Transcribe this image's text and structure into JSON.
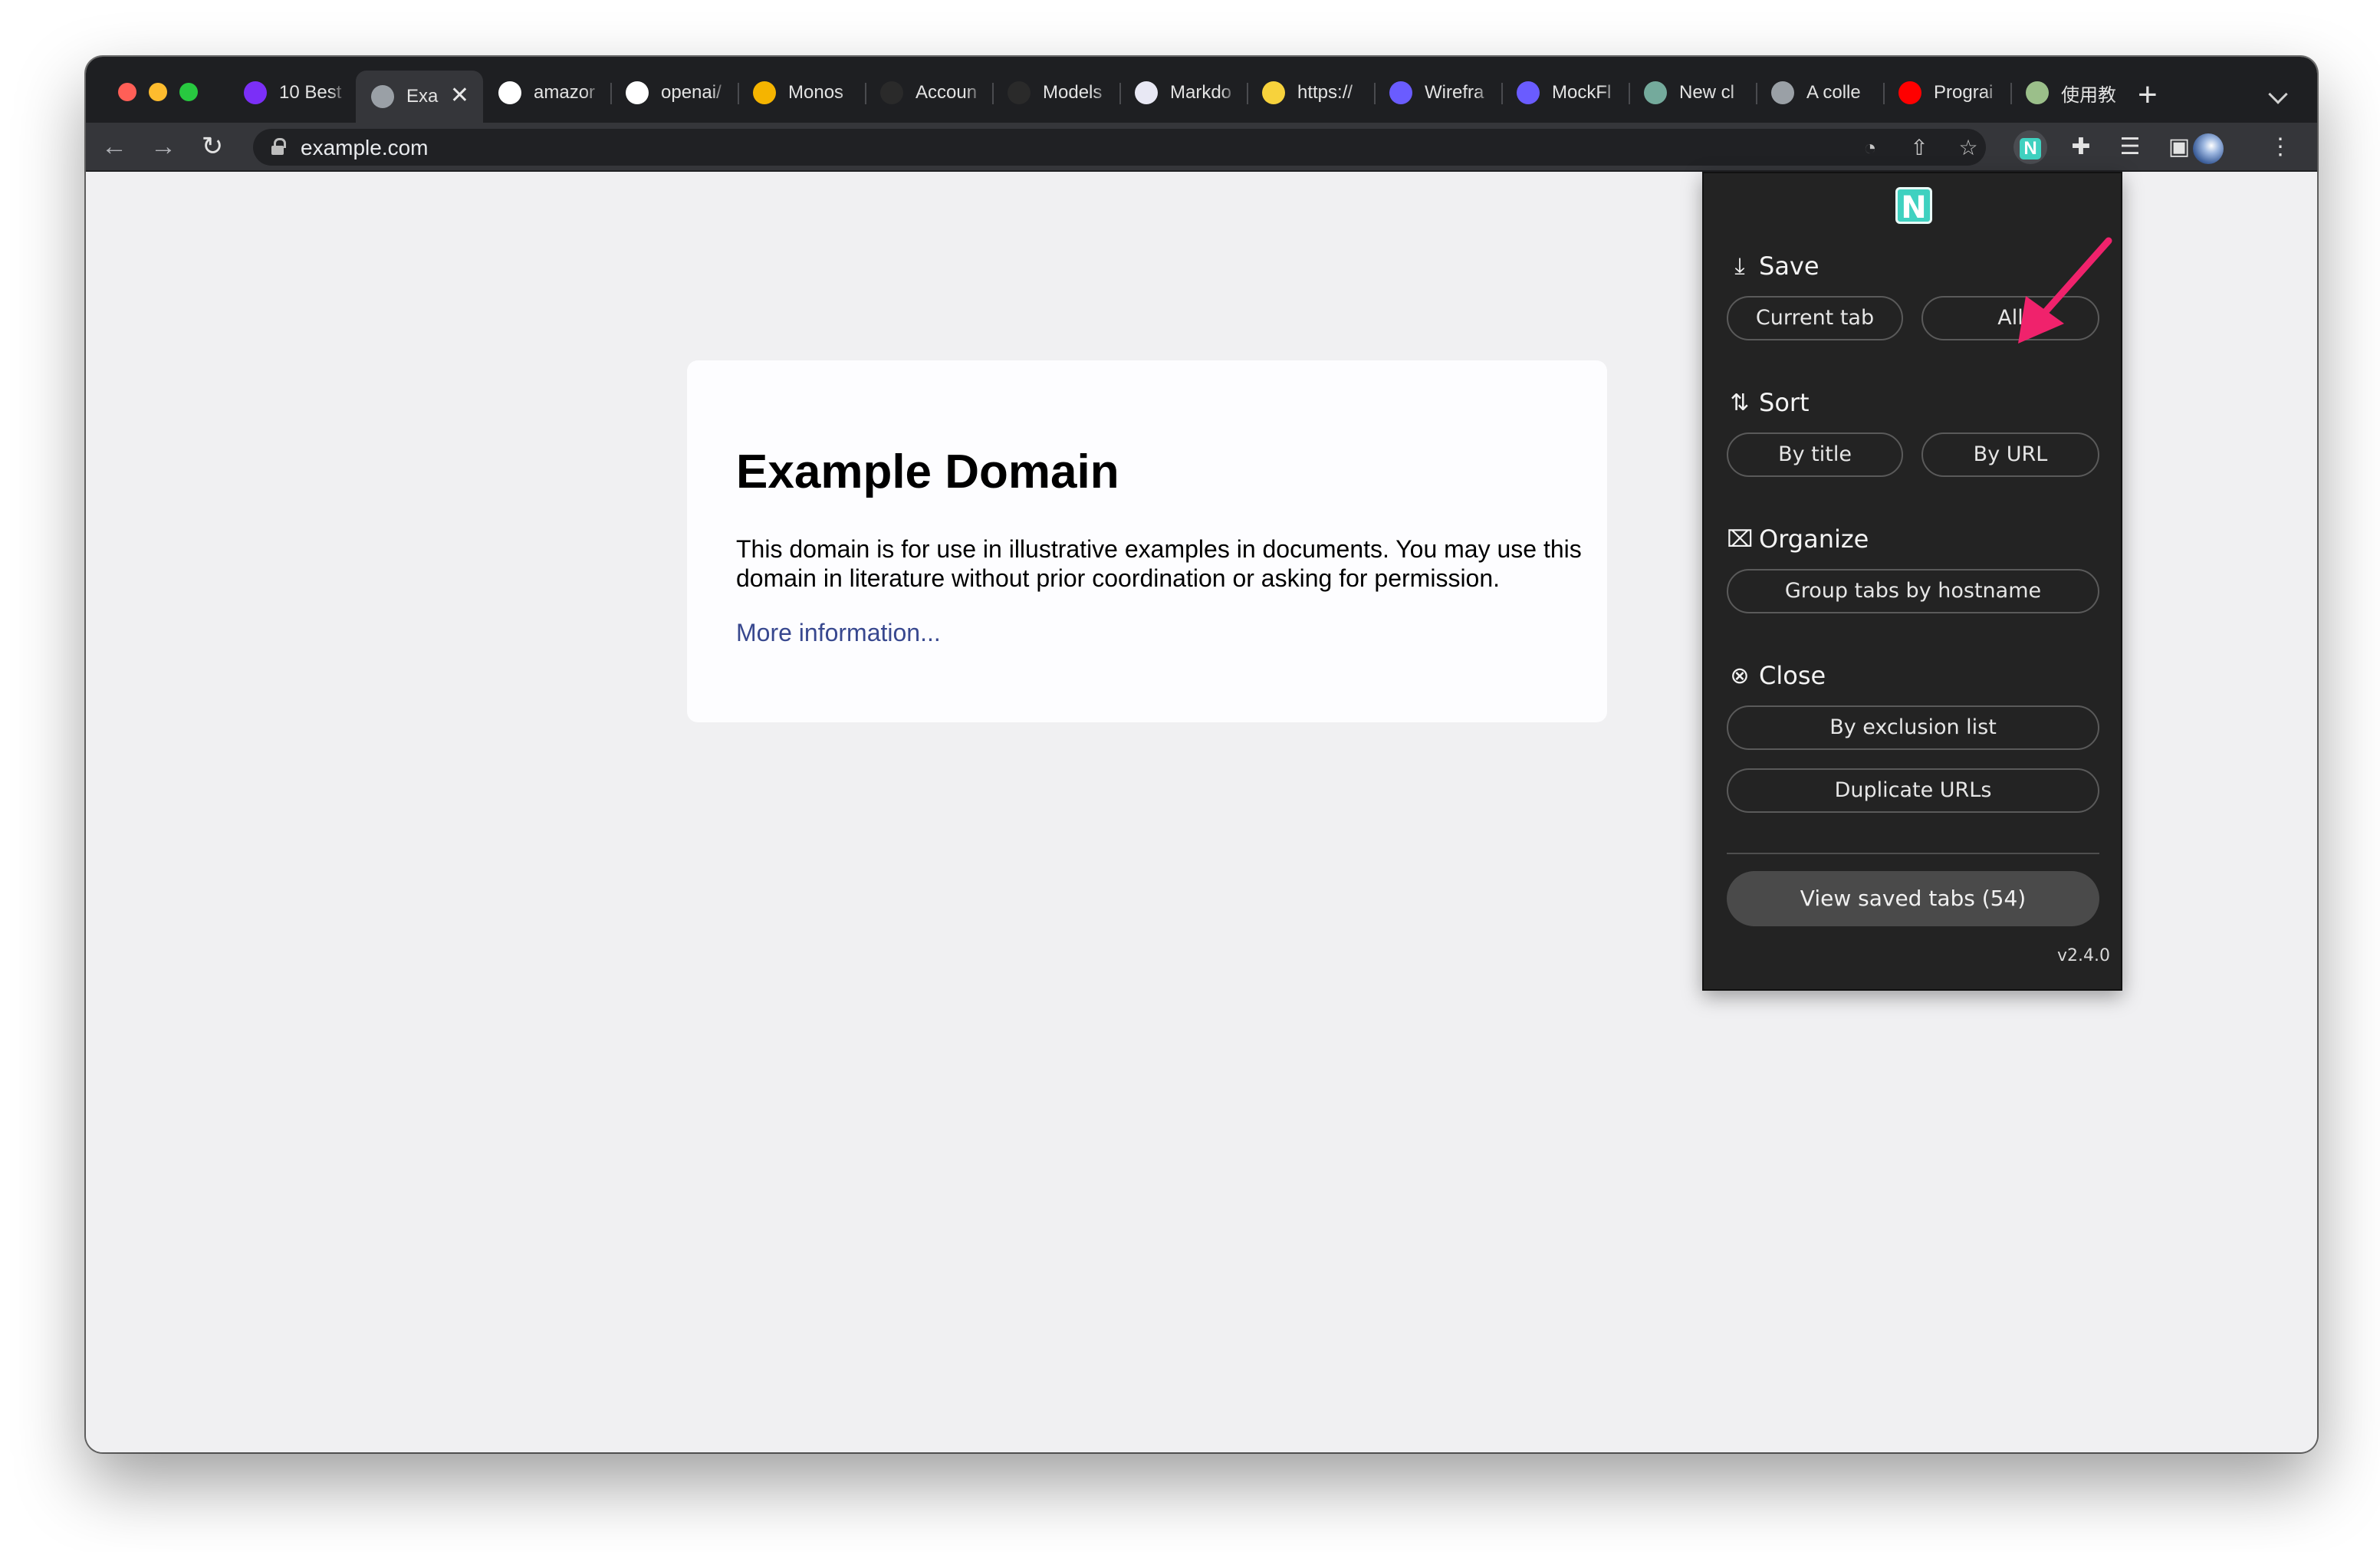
{
  "browser": {
    "tabs": [
      {
        "title": "10 Best",
        "icon": "purple-c-icon",
        "color": "#7b2ff7"
      },
      {
        "title": "Exa",
        "icon": "globe-icon",
        "color": "#9aa0a6",
        "active": true
      },
      {
        "title": "amazor",
        "icon": "github-icon",
        "color": "#ffffff"
      },
      {
        "title": "openai/",
        "icon": "github-icon",
        "color": "#ffffff"
      },
      {
        "title": "Monos",
        "icon": "bolt-icon",
        "color": "#f5b400"
      },
      {
        "title": "Accoun",
        "icon": "openai-icon",
        "color": "#2a2a2a"
      },
      {
        "title": "Models",
        "icon": "openai-icon",
        "color": "#2a2a2a"
      },
      {
        "title": "Markdo",
        "icon": "markdown-icon",
        "color": "#e8e8f4"
      },
      {
        "title": "https://",
        "icon": "sparkle-icon",
        "color": "#f7d23c"
      },
      {
        "title": "Wirefra",
        "icon": "mockflow-icon",
        "color": "#6a5cff"
      },
      {
        "title": "MockFl",
        "icon": "mockflow-icon",
        "color": "#6a5cff"
      },
      {
        "title": "New cl",
        "icon": "chatgpt-icon",
        "color": "#74aa9c"
      },
      {
        "title": "A colle",
        "icon": "globe-icon",
        "color": "#9aa0a6"
      },
      {
        "title": "Prograi",
        "icon": "youtube-icon",
        "color": "#ff0000"
      },
      {
        "title": "使用教",
        "icon": "flower-icon",
        "color": "#9bbf8a"
      }
    ],
    "active_tab_close": "✕",
    "new_tab": "+",
    "url": "example.com"
  },
  "page": {
    "heading": "Example Domain",
    "body": "This domain is for use in illustrative examples in documents. You may use this domain in literature without prior coordination or asking for permission.",
    "link": "More information..."
  },
  "extension": {
    "logo_letter": "N",
    "save": {
      "title": "Save",
      "current_tab": "Current tab",
      "all": "All"
    },
    "sort": {
      "title": "Sort",
      "by_title": "By title",
      "by_url": "By URL"
    },
    "organize": {
      "title": "Organize",
      "group": "Group tabs by hostname"
    },
    "close": {
      "title": "Close",
      "exclusion": "By exclusion list",
      "duplicates": "Duplicate URLs"
    },
    "view_saved": "View saved tabs (54)",
    "version": "v2.4.0",
    "accent": "#3fd1c0"
  },
  "colors": {
    "annotation_arrow": "#f0226c"
  }
}
